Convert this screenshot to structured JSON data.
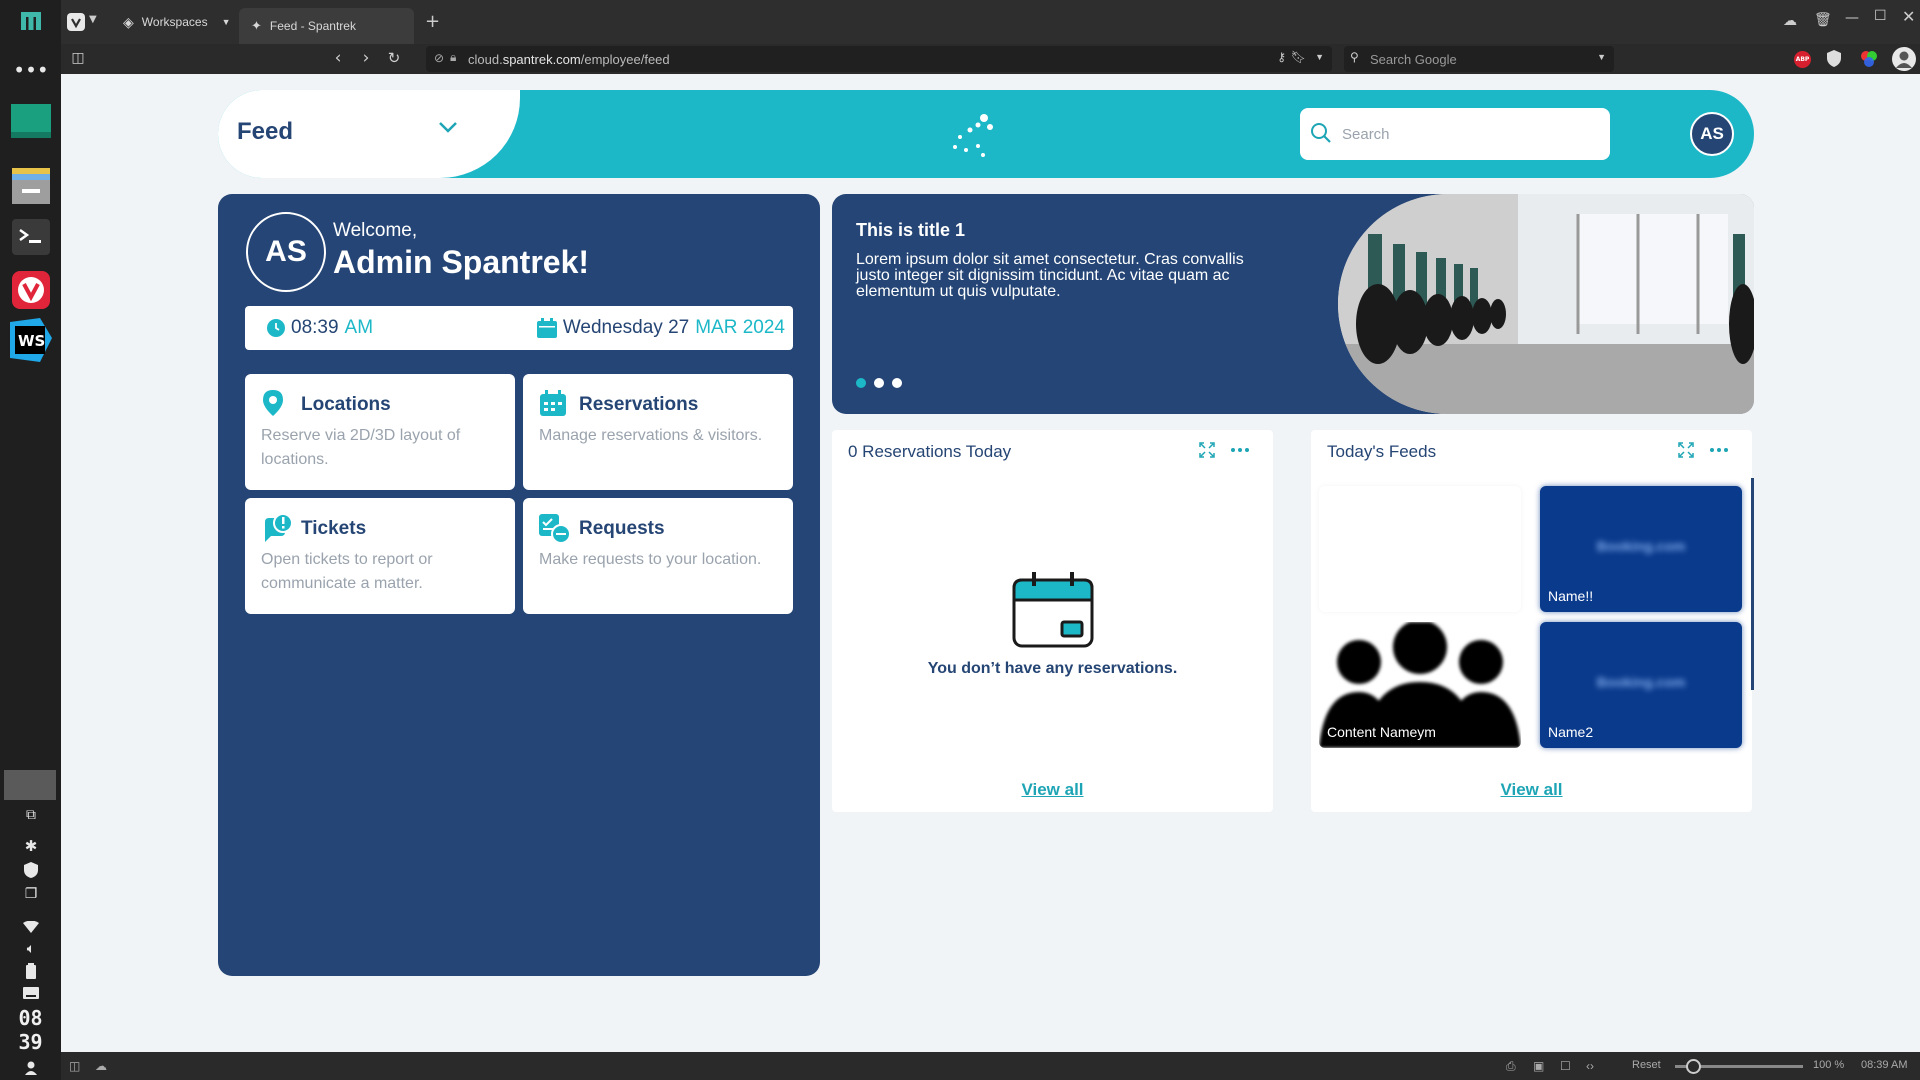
{
  "os": {
    "clock_hour": "08",
    "clock_min": "39"
  },
  "browser": {
    "tabs": [
      {
        "label": "Workspaces"
      },
      {
        "label": "Feed - Spantrek"
      }
    ],
    "url_prefix": "cloud.",
    "url_host": "spantrek.com",
    "url_path": "/employee/feed",
    "search_placeholder": "Search Google",
    "status": {
      "reset": "Reset",
      "zoom": "100 %",
      "time": "08:39 AM"
    }
  },
  "header": {
    "page_title": "Feed",
    "search_placeholder": "Search",
    "user_initials": "AS"
  },
  "welcome": {
    "initials": "AS",
    "greeting": "Welcome,",
    "name": "Admin Spantrek!",
    "time": "08:39",
    "ampm": "AM",
    "weekday_day": "Wednesday 27",
    "month_year": "MAR 2024"
  },
  "tiles": [
    {
      "title": "Locations",
      "desc": "Reserve via 2D/3D layout of locations.",
      "icon": "location-pin-icon"
    },
    {
      "title": "Reservations",
      "desc": "Manage reservations & visitors.",
      "icon": "calendar-icon"
    },
    {
      "title": "Tickets",
      "desc": "Open tickets to report or communicate a matter.",
      "icon": "ticket-chat-icon"
    },
    {
      "title": "Requests",
      "desc": "Make requests to your location.",
      "icon": "requests-icon"
    }
  ],
  "banner": {
    "title": "This is title 1",
    "text": "Lorem ipsum dolor sit amet consectetur. Cras convallis justo integer sit dignissim tincidunt. Ac vitae quam ac elementum ut quis vulputate.",
    "slides": 3,
    "active_slide": 1
  },
  "reservations_card": {
    "title": "0 Reservations Today",
    "empty_message": "You don’t have any reservations.",
    "view_all": "View all"
  },
  "feeds_card": {
    "title": "Today's Feeds",
    "items": [
      {
        "label": ""
      },
      {
        "label": "Name!!"
      },
      {
        "label": "Content Nameym"
      },
      {
        "label": "Name2"
      }
    ],
    "view_all": "View all"
  },
  "colors": {
    "primary": "#244575",
    "accent": "#1db8c8",
    "muted": "#9aa3ad",
    "background": "#f1f4f7"
  }
}
